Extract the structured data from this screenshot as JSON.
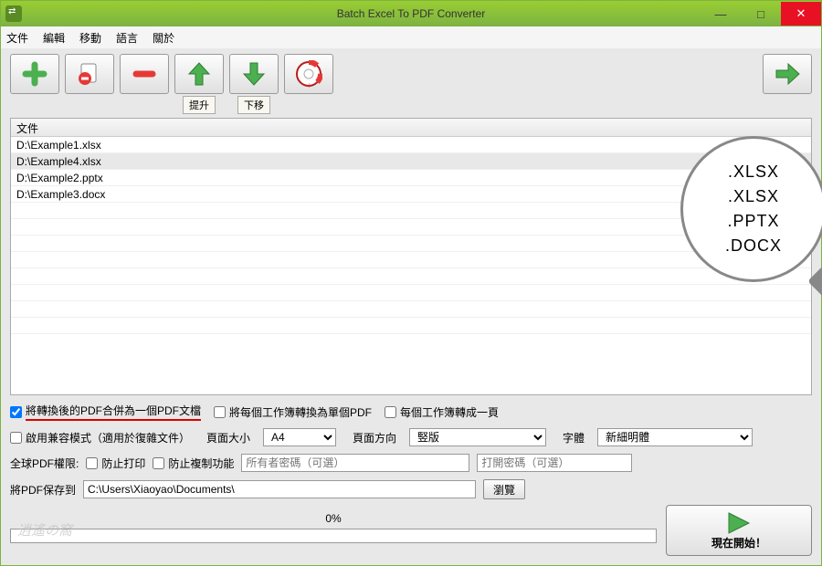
{
  "window": {
    "title": "Batch Excel To PDF Converter"
  },
  "menu": [
    "文件",
    "編輯",
    "移動",
    "語言",
    "關於"
  ],
  "toolbar": {
    "moveup_label": "提升",
    "movedown_label": "下移"
  },
  "list": {
    "header": "文件",
    "rows": [
      "D:\\Example1.xlsx",
      "D:\\Example4.xlsx",
      "D:\\Example2.pptx",
      "D:\\Example3.docx"
    ],
    "selected_index": 1
  },
  "magnifier": [
    ".XLSX",
    ".XLSX",
    ".PPTX",
    ".DOCX"
  ],
  "options": {
    "merge": {
      "label": "將轉換後的PDF合併為一個PDF文檔",
      "checked": true
    },
    "each_workbook": {
      "label": "將每個工作簿轉換為單個PDF",
      "checked": false
    },
    "one_page": {
      "label": "每個工作簿轉成一頁",
      "checked": false
    },
    "compat": {
      "label": "啟用兼容模式（適用於復雜文件）",
      "checked": false
    },
    "page_size": {
      "label": "頁面大小",
      "value": "A4"
    },
    "orientation": {
      "label": "頁面方向",
      "value": "竪版"
    },
    "font": {
      "label": "字體",
      "value": "新細明體"
    }
  },
  "perms": {
    "label": "全球PDF權限:",
    "no_print": {
      "label": "防止打印",
      "checked": false
    },
    "no_copy": {
      "label": "防止複制功能",
      "checked": false
    },
    "owner_pwd_placeholder": "所有者密碼（可選）",
    "open_pwd_placeholder": "打開密碼（可選）"
  },
  "save": {
    "label": "將PDF保存到",
    "path": "C:\\Users\\Xiaoyao\\Documents\\",
    "browse": "瀏覽"
  },
  "progress": {
    "text": "0%"
  },
  "start": {
    "label": "現在開始！"
  }
}
